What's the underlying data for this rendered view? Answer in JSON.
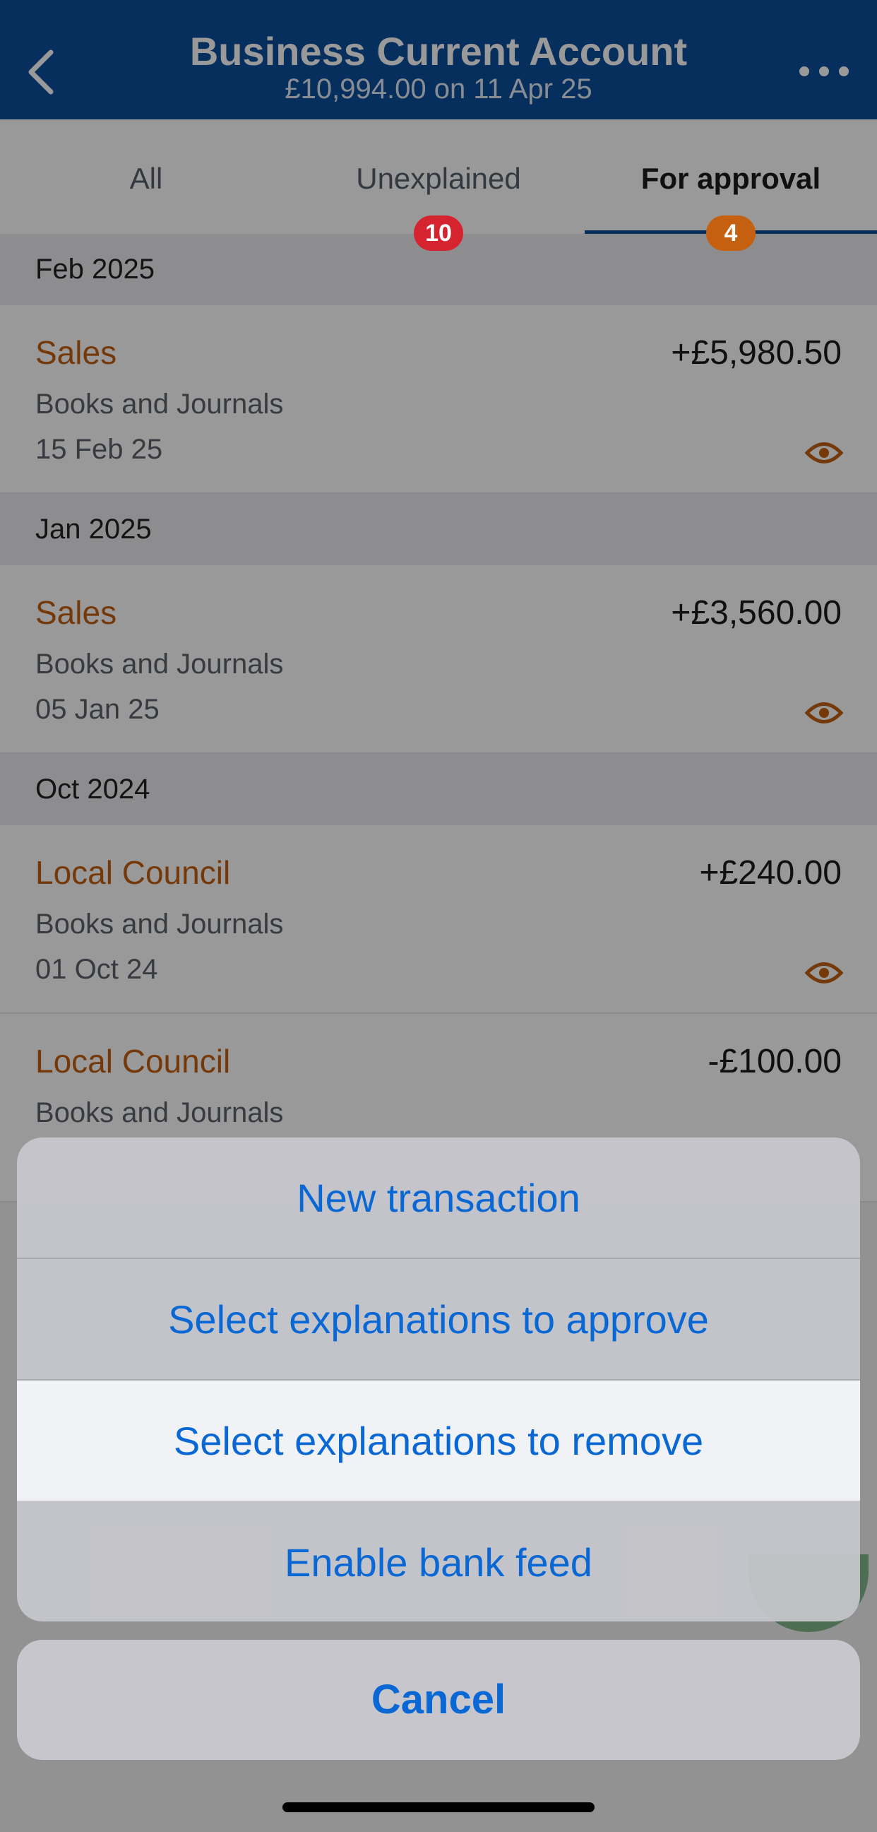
{
  "header": {
    "title": "Business Current Account",
    "subtitle": "£10,994.00 on 11 Apr 25"
  },
  "tabs": [
    {
      "label": "All",
      "badge": ""
    },
    {
      "label": "Unexplained",
      "badge": "10"
    },
    {
      "label": "For approval",
      "badge": "4"
    }
  ],
  "sections": [
    {
      "header": "Feb 2025",
      "rows": [
        {
          "title": "Sales",
          "subtitle": "Books and Journals",
          "date": "15 Feb 25",
          "amount": "+£5,980.50"
        }
      ]
    },
    {
      "header": "Jan 2025",
      "rows": [
        {
          "title": "Sales",
          "subtitle": "Books and Journals",
          "date": "05 Jan 25",
          "amount": "+£3,560.00"
        }
      ]
    },
    {
      "header": "Oct 2024",
      "rows": [
        {
          "title": "Local Council",
          "subtitle": "Books and Journals",
          "date": "01 Oct 24",
          "amount": "+£240.00"
        },
        {
          "title": "Local Council",
          "subtitle": "Books and Journals",
          "date": "",
          "amount": "-£100.00"
        }
      ]
    }
  ],
  "action_sheet": {
    "items": [
      "New transaction",
      "Select explanations to approve",
      "Select explanations to remove",
      "Enable bank feed"
    ],
    "cancel": "Cancel"
  },
  "colors": {
    "header_bg": "#0a4f9c",
    "accent_orange": "#c4600f",
    "badge_red": "#d52330",
    "action_blue": "#0a68d4"
  }
}
